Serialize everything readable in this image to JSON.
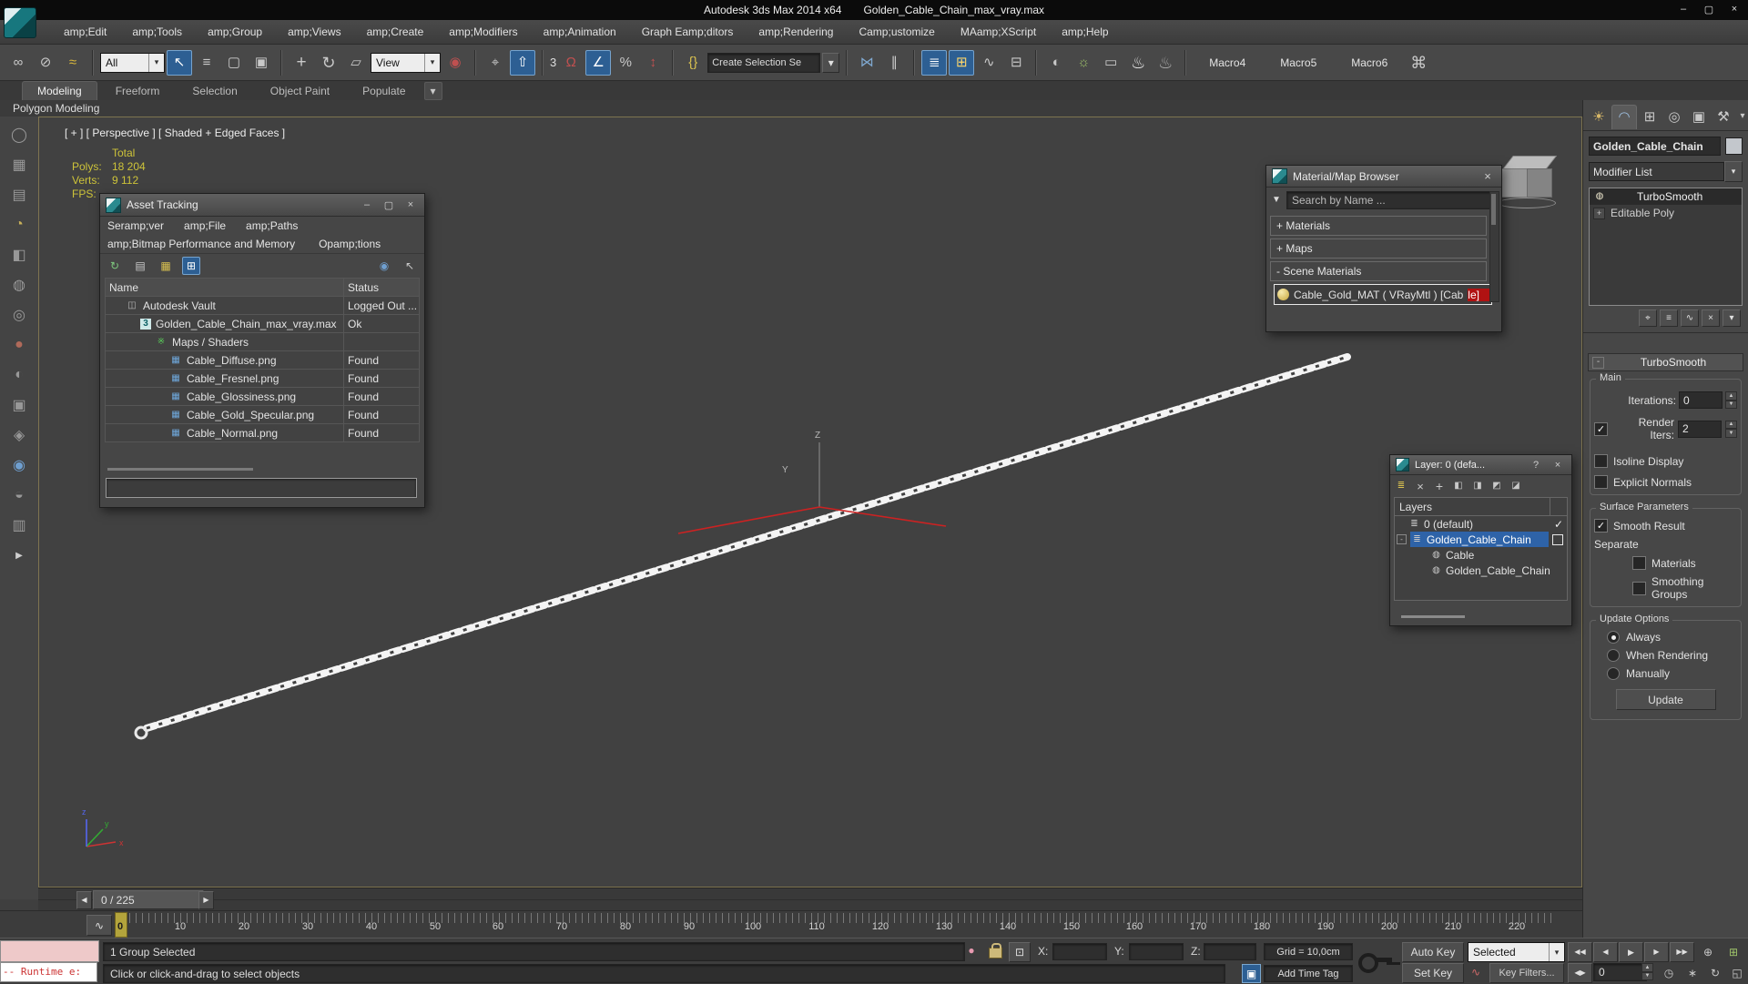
{
  "window": {
    "app_title": "Autodesk 3ds Max  2014 x64",
    "file_title": "Golden_Cable_Chain_max_vray.max",
    "minimize": "–",
    "maximize": "▢",
    "close": "×"
  },
  "menu": {
    "items": [
      "amp;Edit",
      "amp;Tools",
      "amp;Group",
      "amp;Views",
      "amp;Create",
      "amp;Modifiers",
      "amp;Animation",
      "Graph Eamp;ditors",
      "amp;Rendering",
      "Camp;ustomize",
      "MAamp;XScript",
      "amp;Help"
    ]
  },
  "toolbar": {
    "filter_value": "All",
    "coord_value": "View",
    "selection_set_value": "Create Selection Se",
    "snap_label": "3",
    "macros": [
      "Macro4",
      "Macro5",
      "Macro6"
    ]
  },
  "ribbon": {
    "tabs": [
      "Modeling",
      "Freeform",
      "Selection",
      "Object Paint",
      "Populate"
    ],
    "panel_label": "Polygon Modeling"
  },
  "viewport": {
    "label": "[ + ] [ Perspective ] [ Shaded + Edged Faces ]",
    "stats": {
      "total_label": "Total",
      "polys_label": "Polys:",
      "polys_value": "18 204",
      "verts_label": "Verts:",
      "verts_value": "9 112",
      "fps_label": "FPS:"
    },
    "axis_x": "x",
    "axis_y": "y",
    "axis_z": "z",
    "gizmo_y": "Y",
    "gizmo_z": "Z"
  },
  "asset_tracking": {
    "title": "Asset Tracking",
    "menus_row1": [
      "Seramp;ver",
      "amp;File",
      "amp;Paths"
    ],
    "menus_row2": [
      "amp;Bitmap Performance and Memory",
      "Opamp;tions"
    ],
    "columns": [
      "Name",
      "Status"
    ],
    "rows": [
      {
        "name": "Autodesk Vault",
        "status": "Logged Out ..."
      },
      {
        "name": "Golden_Cable_Chain_max_vray.max",
        "status": "Ok"
      },
      {
        "name": "Maps / Shaders",
        "status": ""
      },
      {
        "name": "Cable_Diffuse.png",
        "status": "Found"
      },
      {
        "name": "Cable_Fresnel.png",
        "status": "Found"
      },
      {
        "name": "Cable_Glossiness.png",
        "status": "Found"
      },
      {
        "name": "Cable_Gold_Specular.png",
        "status": "Found"
      },
      {
        "name": "Cable_Normal.png",
        "status": "Found"
      }
    ]
  },
  "material_browser": {
    "title": "Material/Map Browser",
    "search_placeholder": "Search by Name ...",
    "groups": [
      "+ Materials",
      "+ Maps",
      "- Scene Materials"
    ],
    "material_name": "Cable_Gold_MAT ( VRayMtl ) [Cab",
    "material_name_highlight": "le]"
  },
  "layer_dialog": {
    "title": "Layer: 0 (defa...",
    "help": "?",
    "header": "Layers",
    "check": "✓",
    "rows": [
      "0 (default)",
      "Golden_Cable_Chain",
      "Cable",
      "Golden_Cable_Chain"
    ]
  },
  "command_panel": {
    "object_name": "Golden_Cable_Chain",
    "modifier_list": "Modifier List",
    "stack": [
      "TurboSmooth",
      "Editable Poly"
    ],
    "rollout": {
      "title": "TurboSmooth",
      "main_label": "Main",
      "iterations_label": "Iterations:",
      "iterations_value": "0",
      "render_iters_label": "Render Iters:",
      "render_iters_value": "2",
      "isoline_label": "Isoline Display",
      "explicit_label": "Explicit Normals",
      "surface_label": "Surface Parameters",
      "smooth_label": "Smooth Result",
      "separate_label": "Separate",
      "materials_label": "Materials",
      "smoothing_label": "Smoothing Groups",
      "update_label": "Update Options",
      "always_label": "Always",
      "when_label": "When Rendering",
      "manually_label": "Manually",
      "update_button": "Update"
    }
  },
  "timeline": {
    "current": "0 / 225",
    "ticks": [
      "0",
      "10",
      "20",
      "30",
      "40",
      "50",
      "60",
      "70",
      "80",
      "90",
      "100",
      "110",
      "120",
      "130",
      "140",
      "150",
      "160",
      "170",
      "180",
      "190",
      "200",
      "210",
      "220"
    ]
  },
  "statusbar": {
    "maxscript_text": "-- Runtime e:",
    "status_text": "1 Group Selected",
    "prompt_text": "Click or click-and-drag to select objects",
    "x_label": "X:",
    "y_label": "Y:",
    "z_label": "Z:",
    "grid_text": "Grid = 10,0cm",
    "add_time_tag": "Add Time Tag",
    "auto_key": "Auto Key",
    "set_key": "Set Key",
    "selected_value": "Selected",
    "key_filters": "Key Filters...",
    "frame_value": "0"
  },
  "colors": {
    "selection_blue": "#2e63a8",
    "highlight_blue": "#2d5f93",
    "status_red": "#b01212",
    "stats_yellow": "#cdc339",
    "maxscript_pink": "#eec9c9"
  },
  "icons": {
    "link": "∞",
    "unlink": "⊘",
    "bind": "≈",
    "select": "↖",
    "select_by_name": "≡",
    "region": "▢",
    "window_crossing": "▣",
    "move": "+",
    "rotate": "↻",
    "scale": "▱",
    "pivot": "◉",
    "manipulate": "⌖",
    "keyboard": "⇧",
    "magnet": "Ω",
    "angle": "∠",
    "percent": "%",
    "spinner_snap": "↕",
    "named_sets": "{}",
    "mirror": "⋈",
    "align": "∥",
    "layers": "≣",
    "graph": "⊟",
    "curve": "∿",
    "scene": "⊞",
    "material_editor": "◐",
    "render_setup": "☼",
    "render_frame": "▭",
    "teapot": "♨",
    "robot": "⌘",
    "dropdown": "▾",
    "search_filter": "▼",
    "refresh": "↻",
    "doc": "▤",
    "settings": "▦",
    "table": "⊞",
    "info": "◉",
    "pointer": "↖",
    "vault": "◫",
    "maxfile": "3",
    "shaders": "※",
    "bitmap": "▦",
    "bulb": "◍",
    "plusbox": "+",
    "minusbox": "-",
    "tab_create": "☀",
    "tab_modify": "◠",
    "tab_hier": "⊞",
    "tab_motion": "◎",
    "tab_display": "▣",
    "tab_utils": "⚒",
    "go_start": "◀◀",
    "step_back": "◀",
    "play": "▶",
    "step_fwd": "▶",
    "go_end": "▶▶",
    "key_step": "◀▶",
    "zoom": "⊕",
    "zoom_all": "⊞",
    "extents": "▣",
    "extents_all": "⊞",
    "pan": "∗",
    "orbit": "↻",
    "maximize": "◱",
    "time_config": "◷",
    "balloon": "●",
    "abs_mode": "⊡",
    "cube_tag": "▣",
    "key_mode": "▷",
    "expand": "▶",
    "pin": "⌖",
    "show_end": "≡",
    "unique": "∿",
    "remove_mod": "×",
    "config_sets": "▾"
  }
}
